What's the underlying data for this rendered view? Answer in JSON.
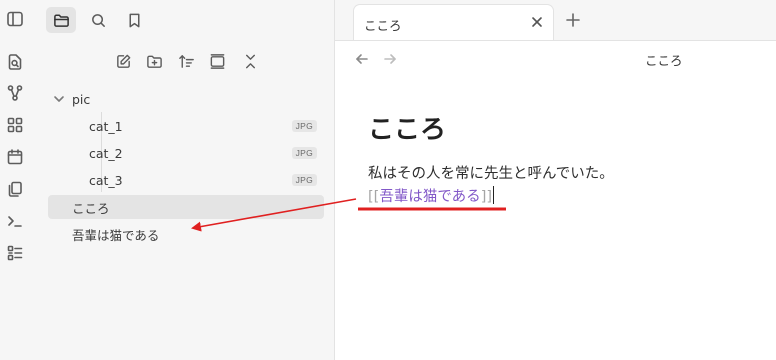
{
  "ribbon": {
    "icons": [
      "sidebar-toggle-icon",
      "open-quick-switcher-icon",
      "graph-icon",
      "canvas-icon",
      "calendar-icon",
      "pages-icon",
      "command-icon",
      "template-icon"
    ]
  },
  "sidebar": {
    "tabs": [
      "file-explorer",
      "search",
      "bookmarks"
    ],
    "actions": [
      "new-note",
      "new-folder",
      "sort",
      "auto-reveal",
      "collapse-all"
    ],
    "folder": {
      "name": "pic"
    },
    "files": [
      {
        "name": "cat_1",
        "ext": "JPG"
      },
      {
        "name": "cat_2",
        "ext": "JPG"
      },
      {
        "name": "cat_3",
        "ext": "JPG"
      }
    ],
    "notes": [
      {
        "name": "こころ",
        "active": true
      },
      {
        "name": "吾輩は猫である",
        "active": false
      }
    ]
  },
  "tab": {
    "title": "こころ"
  },
  "view": {
    "title": "こころ"
  },
  "document": {
    "heading": "こころ",
    "paragraph": "私はその人を常に先生と呼んでいた。",
    "link_open": "[[",
    "link_text": "吾輩は猫である",
    "link_close": "]]"
  },
  "colors": {
    "accent": "#8258c8",
    "annotation": "#e02020"
  }
}
